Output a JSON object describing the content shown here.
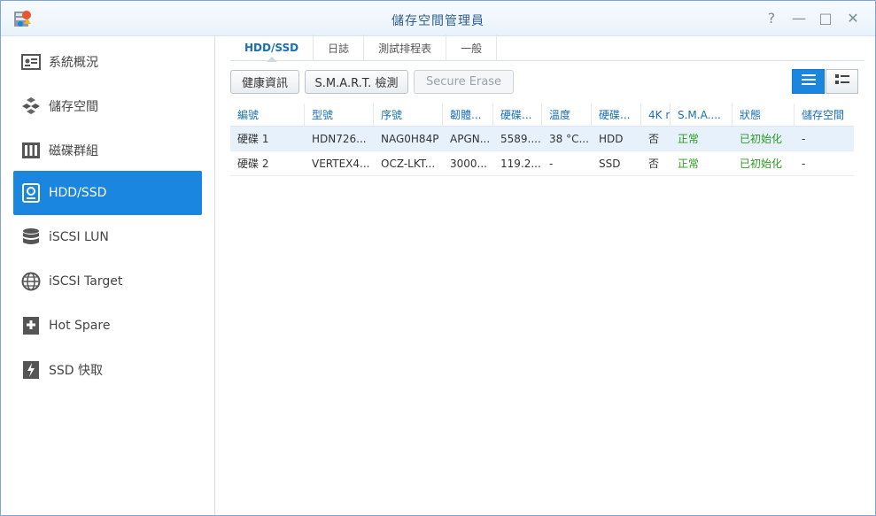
{
  "window": {
    "title": "儲存空間管理員"
  },
  "controls": {
    "help": "?",
    "minimize": "—",
    "maximize": "□",
    "close": "✕"
  },
  "sidebar": {
    "items": [
      {
        "label": "系統概況",
        "icon": "overview-icon"
      },
      {
        "label": "儲存空間",
        "icon": "cubes-icon"
      },
      {
        "label": "磁碟群組",
        "icon": "disk-group-icon"
      },
      {
        "label": "HDD/SSD",
        "icon": "hdd-icon",
        "active": true
      },
      {
        "label": "iSCSI LUN",
        "icon": "database-icon"
      },
      {
        "label": "iSCSI Target",
        "icon": "globe-icon"
      },
      {
        "label": "Hot Spare",
        "icon": "plus-box-icon"
      },
      {
        "label": "SSD 快取",
        "icon": "lightning-icon"
      }
    ]
  },
  "tabs": [
    {
      "label": "HDD/SSD",
      "active": true
    },
    {
      "label": "日誌"
    },
    {
      "label": "測試排程表"
    },
    {
      "label": "一般"
    }
  ],
  "toolbar": {
    "health_label": "健康資訊",
    "smart_label": "S.M.A.R.T. 檢測",
    "erase_label": "Secure Erase"
  },
  "table": {
    "headers": [
      "編號",
      "型號",
      "序號",
      "韌體...",
      "硬碟...",
      "溫度",
      "硬碟...",
      "4K n",
      "S.M.A....",
      "狀態",
      "儲存空間"
    ],
    "rows": [
      [
        "硬碟 1",
        "HDN726...",
        "NAG0H84P",
        "APGN...",
        "5589....",
        "38 °C...",
        "HDD",
        "否",
        "正常",
        "已初始化",
        "-"
      ],
      [
        "硬碟 2",
        "VERTEX4...",
        "OCZ-LKT...",
        "3000...",
        "119.2...",
        "-",
        "SSD",
        "否",
        "正常",
        "已初始化",
        "-"
      ]
    ]
  },
  "colors": {
    "accent": "#1a86e0",
    "ok": "#2d9a1e",
    "header_text": "#1a6fb5"
  }
}
